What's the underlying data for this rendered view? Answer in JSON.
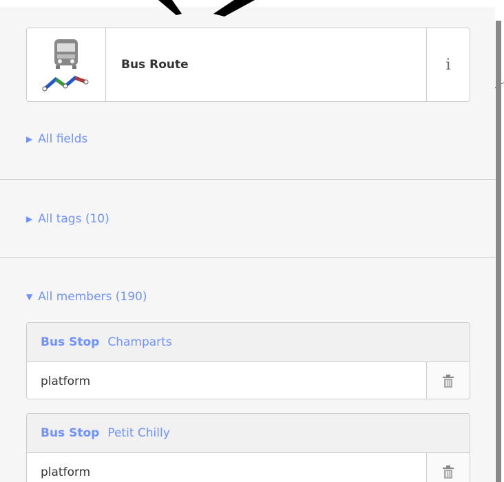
{
  "preset": {
    "name": "Bus Route",
    "icon": "bus-route-icon",
    "info_glyph": "i"
  },
  "sections": {
    "all_fields": "All fields",
    "all_tags": "All tags (10)",
    "all_members": "All members (190)"
  },
  "members": [
    {
      "type": "Bus Stop",
      "name": "Champarts",
      "role": "platform"
    },
    {
      "type": "Bus Stop",
      "name": "Petit Chilly",
      "role": "platform"
    }
  ],
  "colors": {
    "accent": "#7092ff",
    "border": "#cccccc",
    "panel_bg": "#f6f6f6"
  }
}
